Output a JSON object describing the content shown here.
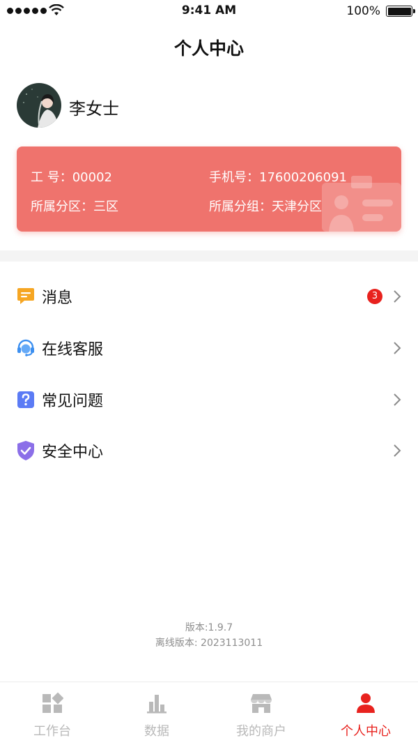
{
  "status_bar": {
    "time": "9:41 AM",
    "battery": "100%"
  },
  "header": {
    "title": "个人中心"
  },
  "profile": {
    "name": "李女士"
  },
  "card": {
    "employee_no_label": "工 号：",
    "employee_no": "00002",
    "phone_label": "手机号：",
    "phone": "17600206091",
    "district_label": "所属分区：",
    "district": "三区",
    "group_label": "所属分组：",
    "group": "天津分区"
  },
  "menu": [
    {
      "label": "消息",
      "icon": "message-icon",
      "badge": "3"
    },
    {
      "label": "在线客服",
      "icon": "customer-service-icon"
    },
    {
      "label": "常见问题",
      "icon": "question-icon"
    },
    {
      "label": "安全中心",
      "icon": "shield-check-icon"
    }
  ],
  "version": {
    "app": "版本:1.9.7",
    "offline": "离线版本: 2023113011"
  },
  "tabs": [
    {
      "label": "工作台",
      "icon": "workbench-icon"
    },
    {
      "label": "数据",
      "icon": "bar-chart-icon"
    },
    {
      "label": "我的商户",
      "icon": "store-icon"
    },
    {
      "label": "个人中心",
      "icon": "person-icon",
      "active": true
    }
  ],
  "colors": {
    "accent": "#e8221e",
    "card": "#ef736d",
    "inactive_tab": "#b9b9b9"
  }
}
